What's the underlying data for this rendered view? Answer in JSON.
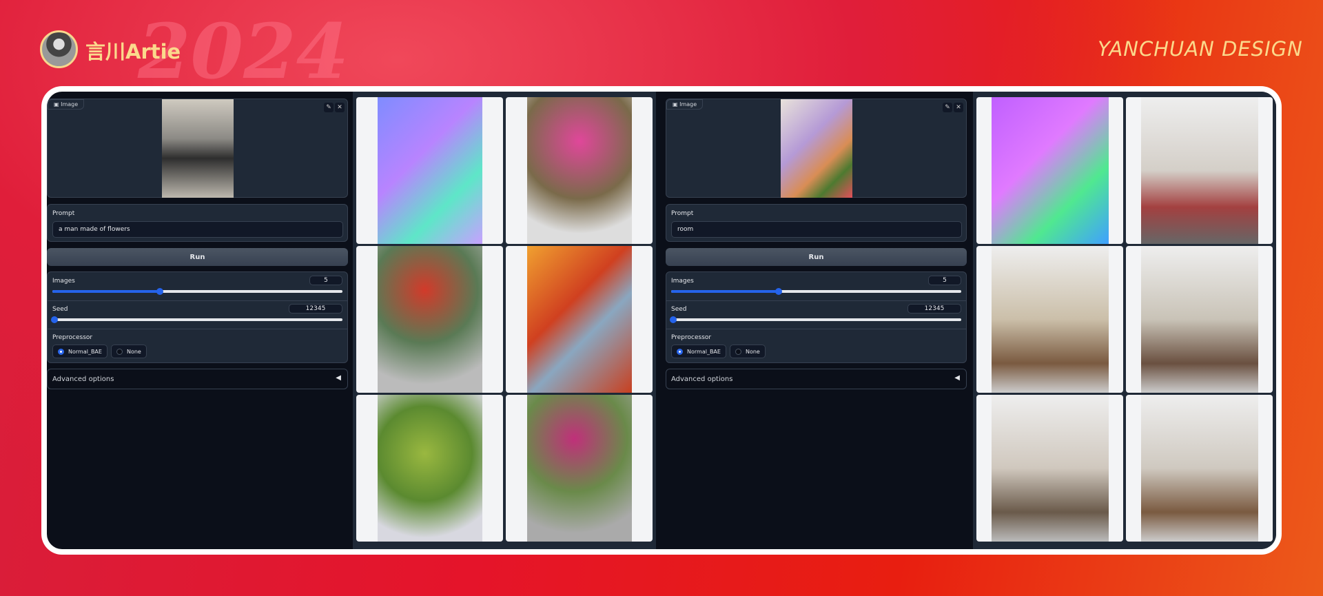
{
  "header": {
    "brand": "言川Artie",
    "right_brand": "YANCHUAN DESIGN",
    "decoration": "2024"
  },
  "left": {
    "image_label": "Image",
    "prompt_label": "Prompt",
    "prompt_value": "a man made of flowers",
    "run_label": "Run",
    "images_label": "Images",
    "images_value": "5",
    "images_fraction": 0.37,
    "seed_label": "Seed",
    "seed_value": "12345",
    "seed_fraction": 0.0,
    "preprocessor_label": "Preprocessor",
    "options": [
      "Normal_BAE",
      "None"
    ],
    "selected": "Normal_BAE",
    "advanced_label": "Advanced options"
  },
  "right": {
    "image_label": "Image",
    "prompt_label": "Prompt",
    "prompt_value": "room",
    "run_label": "Run",
    "images_label": "Images",
    "images_value": "5",
    "images_fraction": 0.37,
    "seed_label": "Seed",
    "seed_value": "12345",
    "seed_fraction": 0.0,
    "preprocessor_label": "Preprocessor",
    "options": [
      "Normal_BAE",
      "None"
    ],
    "selected": "Normal_BAE",
    "advanced_label": "Advanced options"
  },
  "icons": {
    "edit": "pencil-icon",
    "close": "close-icon",
    "image": "image-icon",
    "collapse": "triangle-left-icon"
  }
}
